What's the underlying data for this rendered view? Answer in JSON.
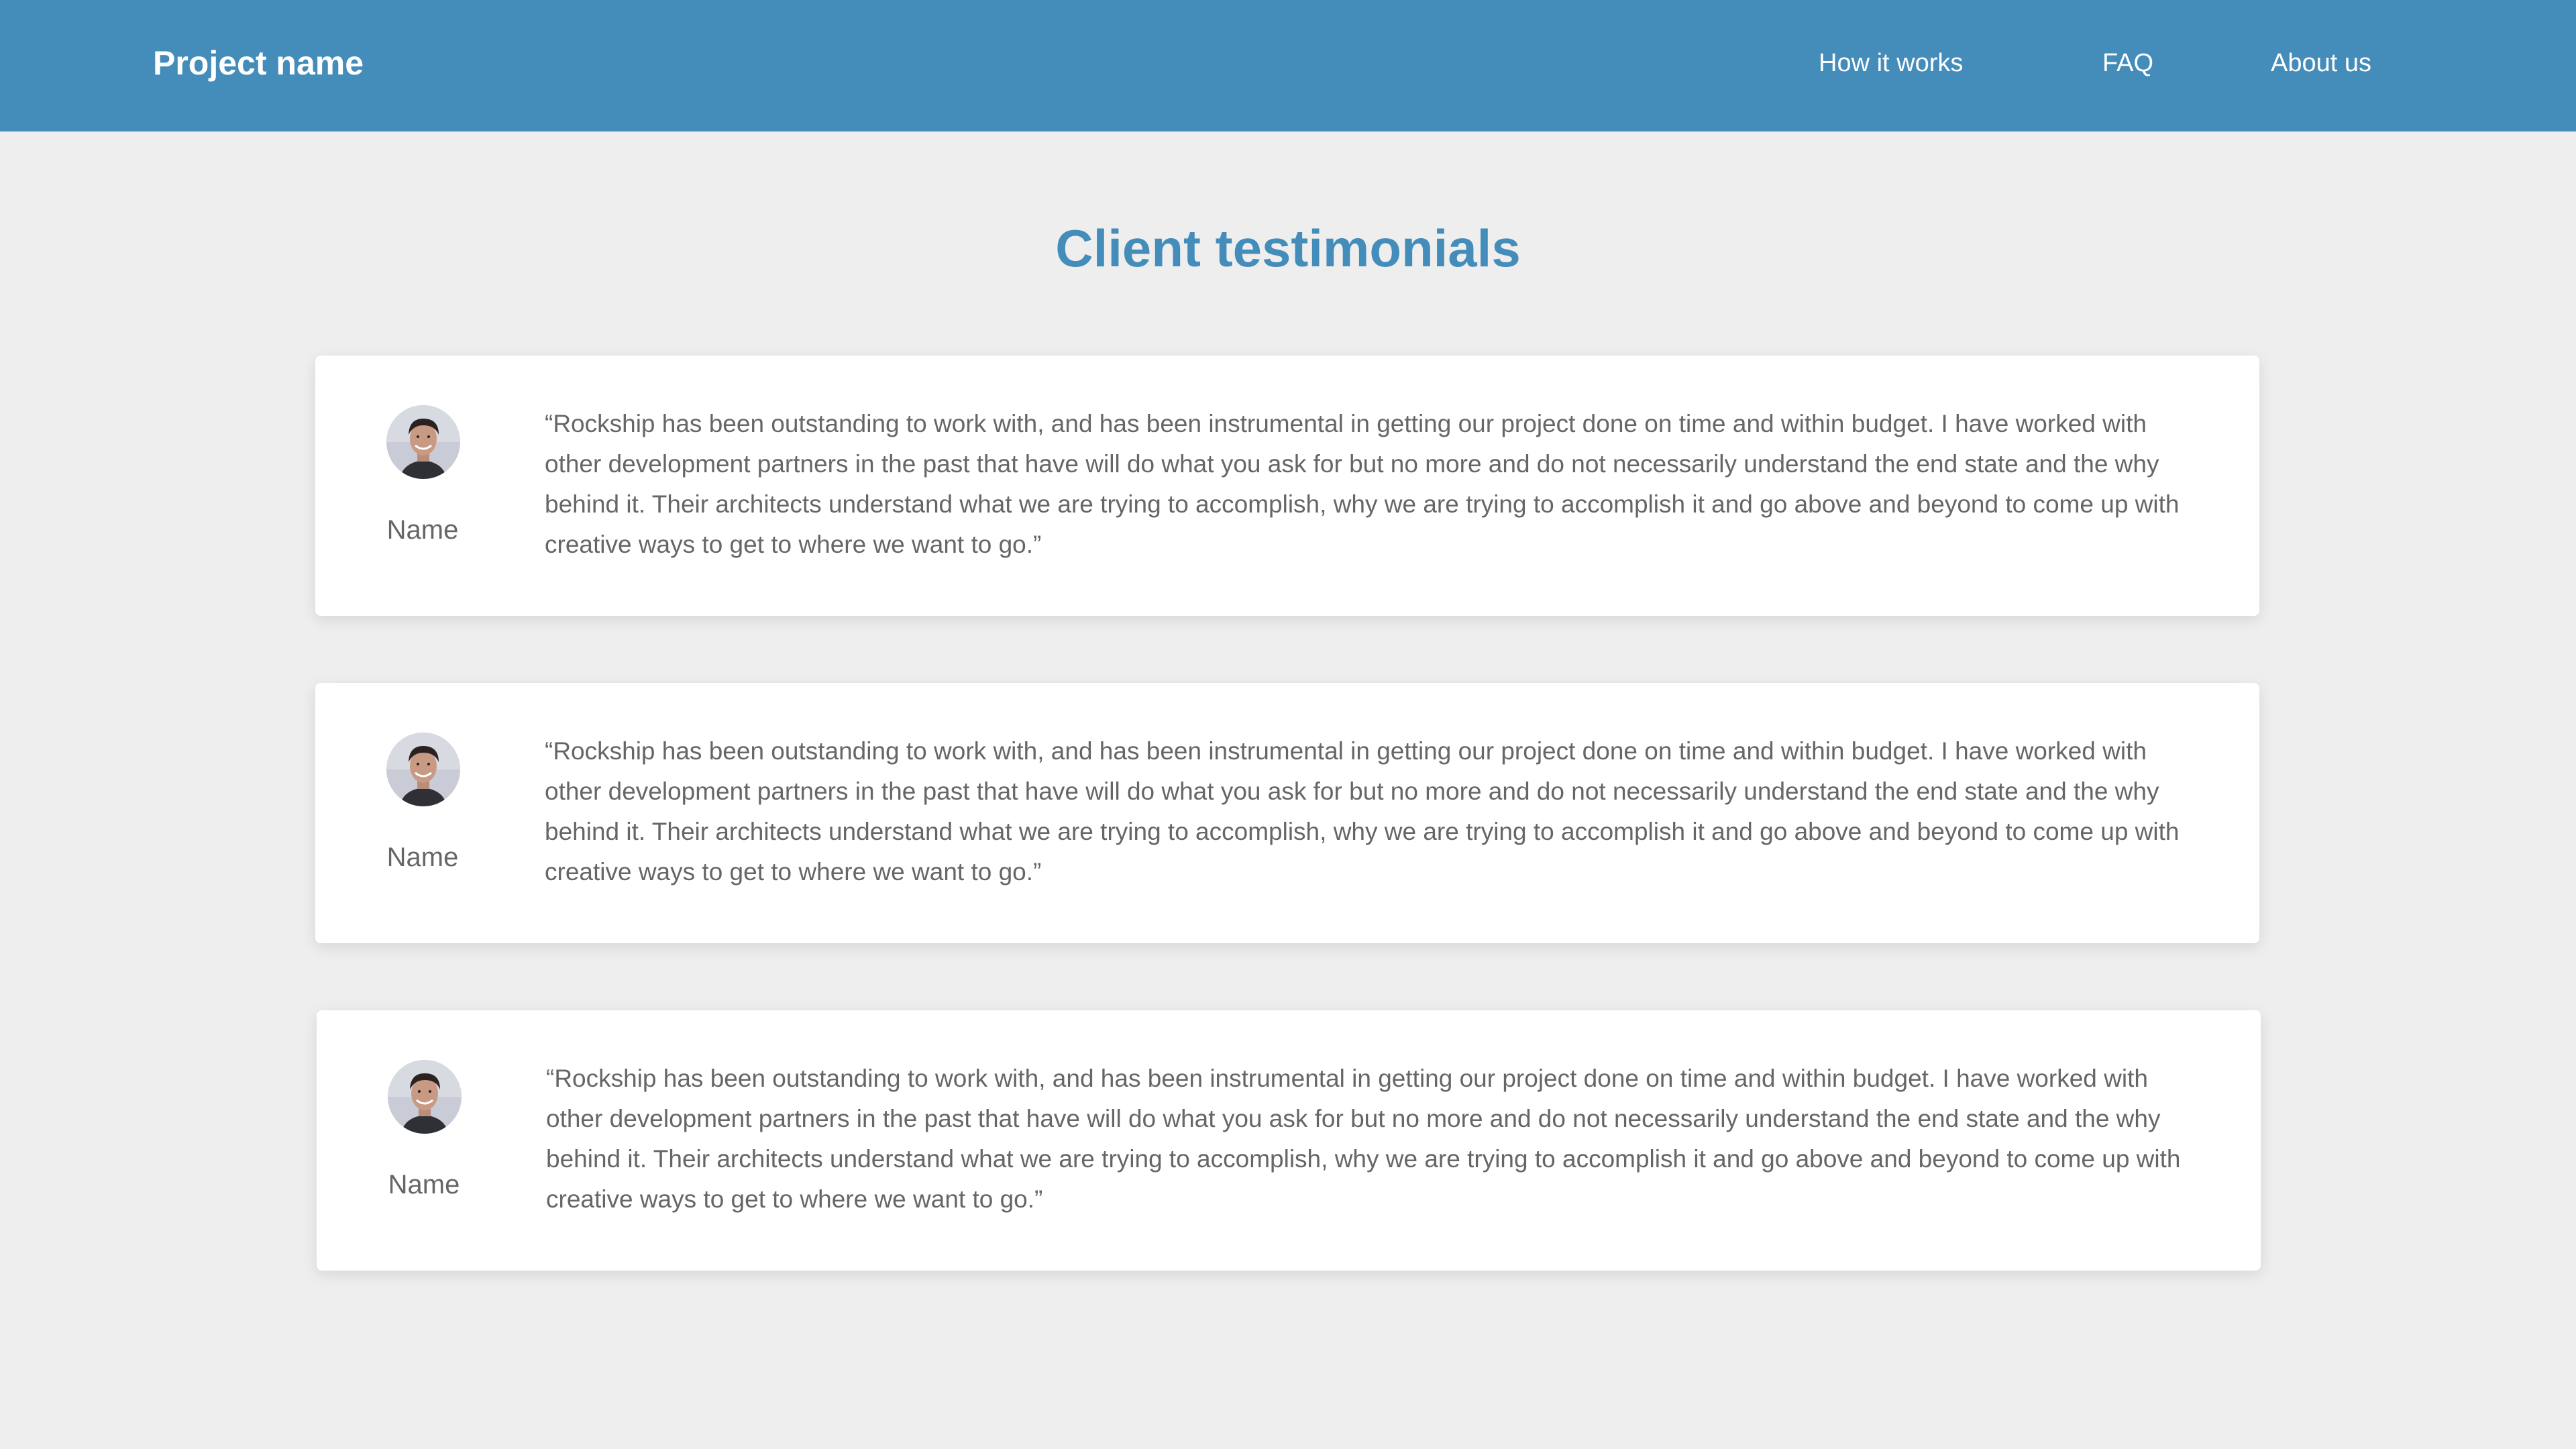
{
  "header": {
    "brand": "Project name",
    "nav": [
      {
        "label": "How it works"
      },
      {
        "label": "FAQ"
      },
      {
        "label": "About us"
      }
    ]
  },
  "main": {
    "title": "Client testimonials",
    "testimonials": [
      {
        "name": "Name",
        "quote": "“Rockship has been outstanding to work with, and has been instrumental in getting our project done on time and within budget. I have worked with other development partners in the past that have will do what you ask for but no more and do not necessarily understand the end state and the why behind it. Their architects understand what we are trying to accomplish, why we are trying to accomplish it and go above and beyond to come up with creative ways to get to where we want to go.”"
      },
      {
        "name": "Name",
        "quote": "“Rockship has been outstanding to work with, and has been instrumental in getting our project done on time and within budget. I have worked with other development partners in the past that have will do what you ask for but no more and do not necessarily understand the end state and the why behind it. Their architects understand what we are trying to accomplish, why we are trying to accomplish it and go above and beyond to come up with creative ways to get to where we want to go.”"
      },
      {
        "name": "Name",
        "quote": "“Rockship has been outstanding to work with, and has been instrumental in getting our project done on time and within budget. I have worked with other development partners in the past that have will do what you ask for but no more and do not necessarily understand the end state and the why behind it. Their architects understand what we are trying to accomplish, why we are trying to accomplish it and go above and beyond to come up with creative ways to get to where we want to go.”"
      }
    ]
  },
  "colors": {
    "brand": "#448dba",
    "background": "#eeeeee",
    "card": "#ffffff",
    "text": "#666666"
  }
}
